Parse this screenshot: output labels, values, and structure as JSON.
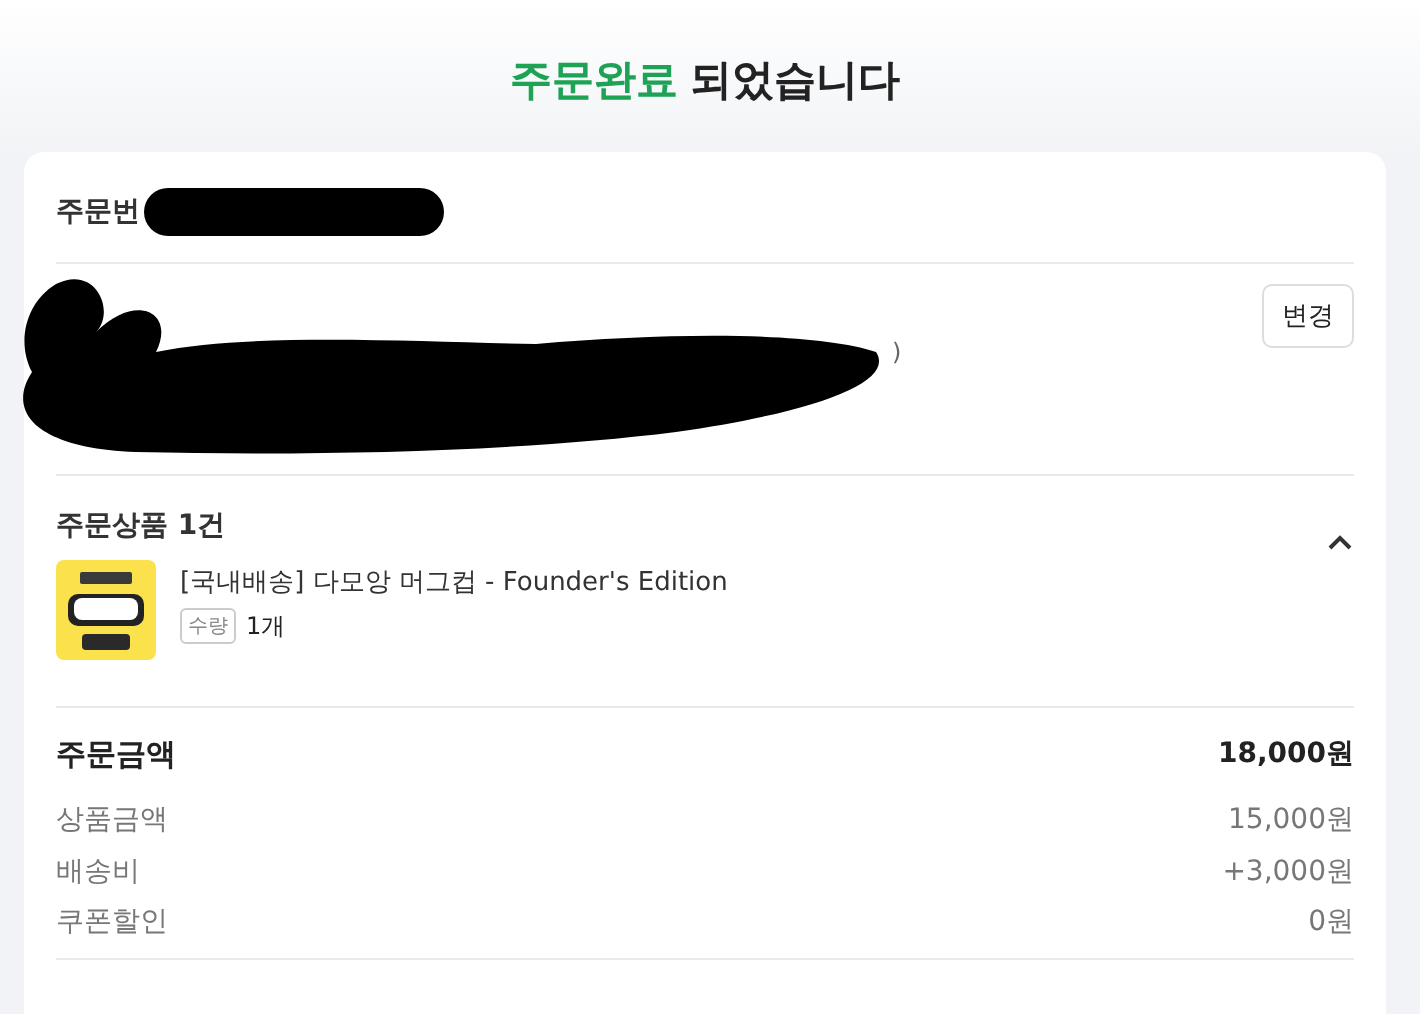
{
  "header": {
    "title_highlight": "주문완료",
    "title_rest": "되었습니다"
  },
  "order": {
    "number_label": "주문번"
  },
  "address": {
    "tail": ")",
    "change_button": "변경"
  },
  "products": {
    "heading": "주문상품 1건",
    "expanded": true,
    "items": [
      {
        "kind": "picture",
        "name": "[국내배송] 다모앙 머그컵 - Founder's Edition",
        "quantity_label": "수량",
        "quantity": "1개"
      }
    ]
  },
  "summary": {
    "total_label": "주문금액",
    "total": "18,000원",
    "lines": [
      {
        "label": "상품금액",
        "value": "15,000원"
      },
      {
        "label": "배송비",
        "value": "+3,000원"
      },
      {
        "label": "쿠폰할인",
        "value": "0원"
      }
    ]
  }
}
